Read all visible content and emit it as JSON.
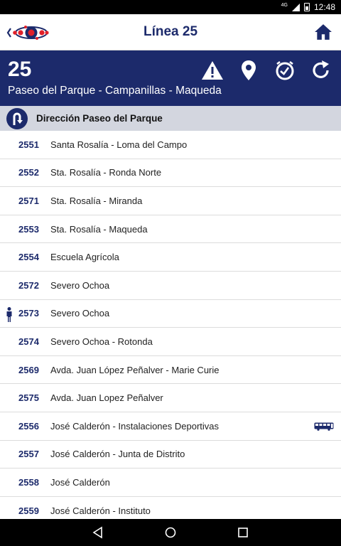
{
  "status_bar": {
    "network": "4G",
    "time": "12:48"
  },
  "app_bar": {
    "title": "Línea 25"
  },
  "line": {
    "number": "25",
    "route": "Paseo del Parque - Campanillas - Maqueda"
  },
  "direction": {
    "label": "Dirección Paseo del Parque"
  },
  "stops": [
    {
      "code": "2551",
      "name": "Santa Rosalía - Loma del Campo"
    },
    {
      "code": "2552",
      "name": "Sta. Rosalía - Ronda Norte"
    },
    {
      "code": "2571",
      "name": "Sta. Rosalía - Miranda"
    },
    {
      "code": "2553",
      "name": "Sta. Rosalía - Maqueda"
    },
    {
      "code": "2554",
      "name": "Escuela Agrícola"
    },
    {
      "code": "2572",
      "name": "Severo Ochoa"
    },
    {
      "code": "2573",
      "name": "Severo Ochoa"
    },
    {
      "code": "2574",
      "name": "Severo Ochoa - Rotonda"
    },
    {
      "code": "2569",
      "name": "Avda. Juan López Peñalver - Marie Curie"
    },
    {
      "code": "2575",
      "name": "Avda. Juan Lopez Peñalver"
    },
    {
      "code": "2556",
      "name": "José Calderón - Instalaciones Deportivas"
    },
    {
      "code": "2557",
      "name": "José Calderón - Junta de Distrito"
    },
    {
      "code": "2558",
      "name": "José Calderón"
    },
    {
      "code": "2559",
      "name": "José Calderón - Instituto"
    }
  ],
  "colors": {
    "brand_blue": "#1c2a6b",
    "direction_bg": "#d3d6df",
    "logo_red": "#e0202a"
  },
  "icons": {
    "back": "back-logo-icon",
    "home": "home-icon",
    "alert": "warning-icon",
    "map": "location-pin-icon",
    "schedule": "clock-icon",
    "refresh": "refresh-icon",
    "direction": "u-turn-icon",
    "user_location": "person-icon",
    "bus": "bus-icon"
  }
}
